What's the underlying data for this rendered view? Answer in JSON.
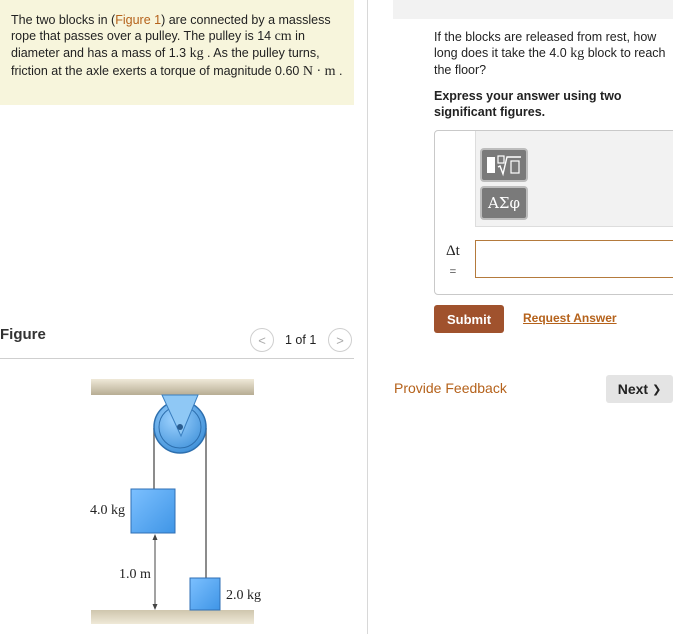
{
  "problem": {
    "text_1": "The two blocks in (",
    "figure_link": "Figure 1",
    "text_2": ") are connected by a massless rope that passes over a pulley. The pulley is 14 ",
    "unit_cm": "cm",
    "text_3": " in diameter and has a mass of 1.3 ",
    "unit_kg": "kg",
    "text_4": " . As the pulley turns, friction at the axle exerts a torque of magnitude 0.60 ",
    "unit_nm": "N · m",
    "text_5": " ."
  },
  "figure": {
    "title": "Figure",
    "prev": "<",
    "pager": "1 of 1",
    "next": ">",
    "labels": {
      "block_left": "4.0 kg",
      "height": "1.0 m",
      "block_right": "2.0 kg"
    }
  },
  "question": {
    "text_1": "If the blocks are released from rest, how long does it take the 4.0 ",
    "unit_kg": "kg",
    "text_2": " block to reach the floor?",
    "instruction": "Express your answer using two significant figures."
  },
  "answer": {
    "variable": "Δt",
    "equals": "=",
    "value": "",
    "tools": {
      "templates_icon": "templates-icon",
      "greek_label": "ΑΣφ",
      "undo": "↶"
    }
  },
  "actions": {
    "submit": "Submit",
    "request_answer": "Request Answer",
    "provide_feedback": "Provide Feedback",
    "next": "Next",
    "next_chevron": "❯"
  },
  "colors": {
    "accent": "#b5621b",
    "submit_bg": "#a0522d",
    "problem_bg": "#f7f5dc",
    "block_blue": "#5aabf0"
  }
}
